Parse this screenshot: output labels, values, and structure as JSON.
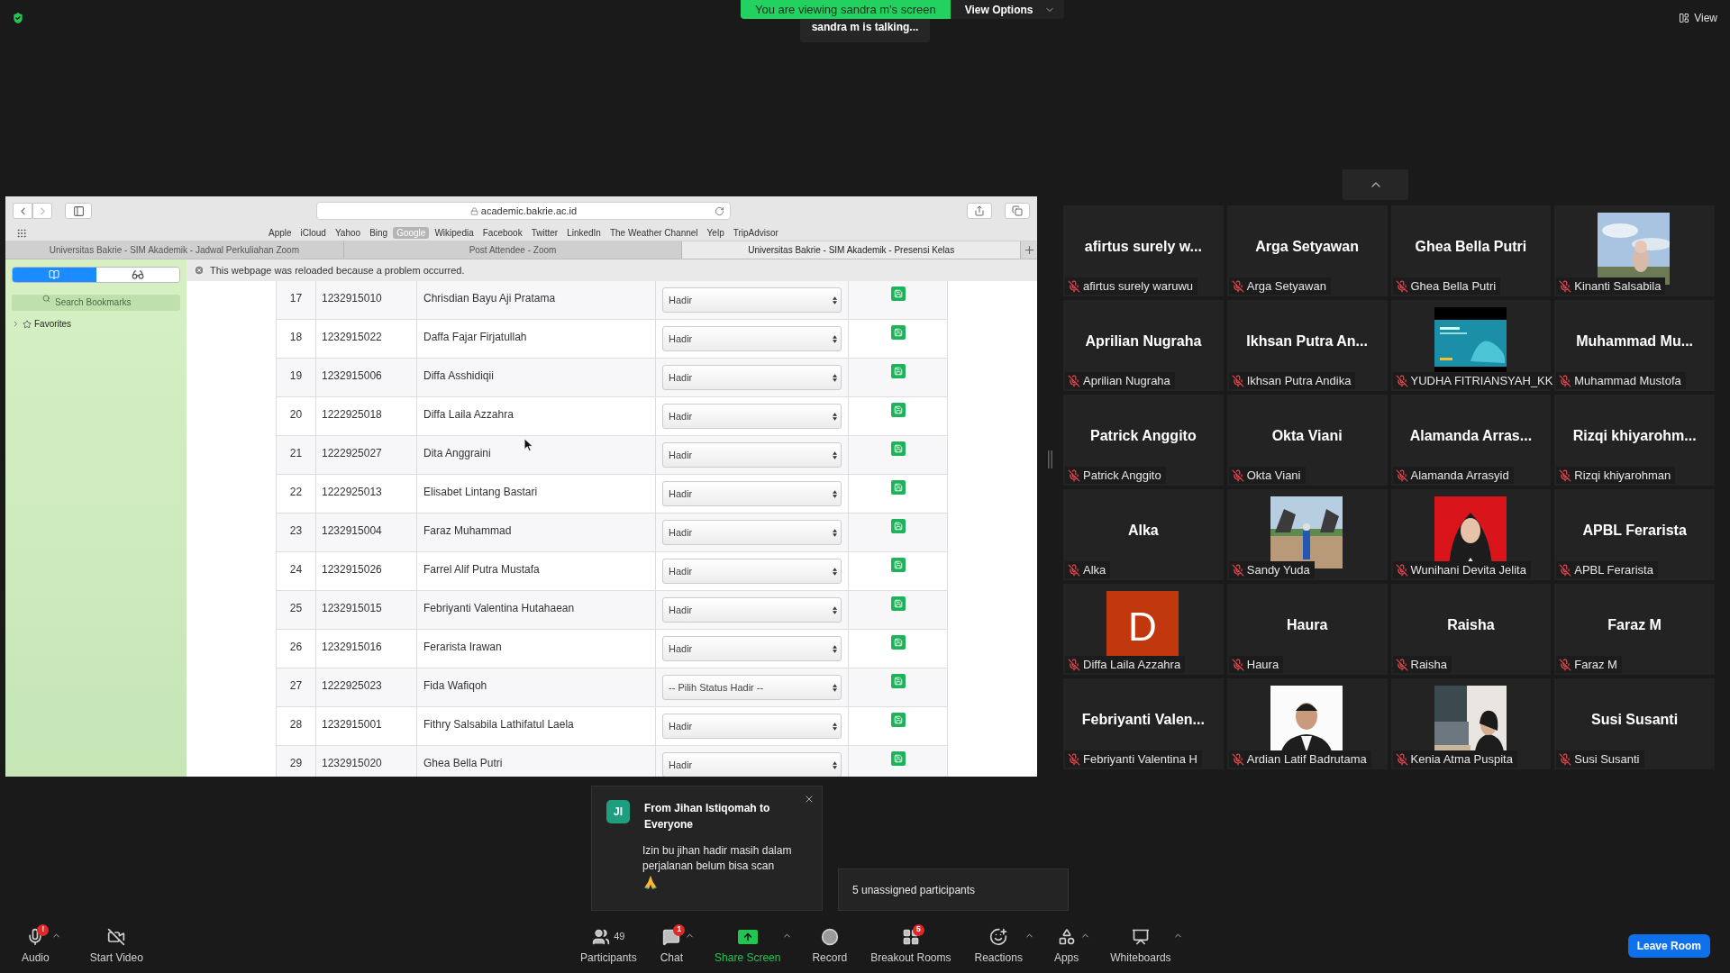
{
  "top": {
    "banner": "You are viewing sandra m's screen",
    "view_options": "View Options",
    "talking": "sandra m is talking...",
    "view": "View"
  },
  "browser": {
    "url": "academic.bakrie.ac.id",
    "bookmarks": [
      {
        "label": "Apple",
        "selected": false
      },
      {
        "label": "iCloud",
        "selected": false
      },
      {
        "label": "Yahoo",
        "selected": false
      },
      {
        "label": "Bing",
        "selected": false
      },
      {
        "label": "Google",
        "selected": true
      },
      {
        "label": "Wikipedia",
        "selected": false
      },
      {
        "label": "Facebook",
        "selected": false
      },
      {
        "label": "Twitter",
        "selected": false
      },
      {
        "label": "LinkedIn",
        "selected": false
      },
      {
        "label": "The Weather Channel",
        "selected": false
      },
      {
        "label": "Yelp",
        "selected": false
      },
      {
        "label": "TripAdvisor",
        "selected": false
      }
    ],
    "tabs": [
      {
        "title": "Universitas Bakrie - SIM Akademik - Jadwal Perkuliahan Zoom",
        "selected": false
      },
      {
        "title": "Post Attendee - Zoom",
        "selected": false
      },
      {
        "title": "Universitas Bakrie - SIM Akademik - Presensi Kelas",
        "selected": true
      }
    ],
    "sidebar": {
      "search_placeholder": "Search Bookmarks",
      "favorites": "Favorites"
    },
    "notice": "This webpage was reloaded because a problem occurred.",
    "rows": [
      {
        "no": "17",
        "nim": "1232915010",
        "name": "Chrisdian Bayu Aji Pratama",
        "status": "Hadir"
      },
      {
        "no": "18",
        "nim": "1232915022",
        "name": "Daffa Fajar Firjatullah",
        "status": "Hadir"
      },
      {
        "no": "19",
        "nim": "1232915006",
        "name": "Diffa Asshidiqii",
        "status": "Hadir"
      },
      {
        "no": "20",
        "nim": "1222925018",
        "name": "Diffa Laila Azzahra",
        "status": "Hadir"
      },
      {
        "no": "21",
        "nim": "1222925027",
        "name": "Dita Anggraini",
        "status": "Hadir"
      },
      {
        "no": "22",
        "nim": "1222925013",
        "name": "Elisabet Lintang Bastari",
        "status": "Hadir"
      },
      {
        "no": "23",
        "nim": "1232915004",
        "name": "Faraz Muhammad",
        "status": "Hadir"
      },
      {
        "no": "24",
        "nim": "1232915026",
        "name": "Farrel Alif Putra Mustafa",
        "status": "Hadir"
      },
      {
        "no": "25",
        "nim": "1232915015",
        "name": "Febriyanti Valentina Hutahaean",
        "status": "Hadir"
      },
      {
        "no": "26",
        "nim": "1232915016",
        "name": "Ferarista Irawan",
        "status": "Hadir"
      },
      {
        "no": "27",
        "nim": "1222925023",
        "name": "Fida Wafiqoh",
        "status": "-- Pilih Status Hadir --"
      },
      {
        "no": "28",
        "nim": "1232915001",
        "name": "Fithry Salsabila Lathifatul Laela",
        "status": "Hadir"
      },
      {
        "no": "29",
        "nim": "1232915020",
        "name": "Ghea Bella Putri",
        "status": "Hadir"
      }
    ]
  },
  "participants": [
    {
      "kind": "name",
      "display": "afirtus surely w...",
      "name": "afirtus surely waruwu",
      "muted": true
    },
    {
      "kind": "name",
      "display": "Arga Setyawan",
      "name": "Arga Setyawan",
      "muted": true
    },
    {
      "kind": "name",
      "display": "Ghea Bella Putri",
      "name": "Ghea Bella Putri",
      "muted": true
    },
    {
      "kind": "picture",
      "name": "Kinanti Salsabila",
      "muted": true
    },
    {
      "kind": "name",
      "display": "Aprilian Nugraha",
      "name": "Aprilian Nugraha",
      "muted": true
    },
    {
      "kind": "name",
      "display": "Ikhsan Putra An...",
      "name": "Ikhsan Putra Andika",
      "muted": true
    },
    {
      "kind": "picture",
      "name": "YUDHA FITRIANSYAH_KK",
      "muted": true
    },
    {
      "kind": "name",
      "display": "Muhammad Mu...",
      "name": "Muhammad Mustofa",
      "muted": true
    },
    {
      "kind": "name",
      "display": "Patrick Anggito",
      "name": "Patrick Anggito",
      "muted": true
    },
    {
      "kind": "name",
      "display": "Okta Viani",
      "name": "Okta Viani",
      "muted": true
    },
    {
      "kind": "name",
      "display": "Alamanda Arras...",
      "name": "Alamanda Arrasyid",
      "muted": true
    },
    {
      "kind": "name",
      "display": "Rizqi khiyarohm...",
      "name": "Rizqi khiyarohman",
      "muted": true
    },
    {
      "kind": "name",
      "display": "Alka",
      "name": "Alka",
      "muted": true
    },
    {
      "kind": "picture",
      "name": "Sandy Yuda",
      "muted": true
    },
    {
      "kind": "picture",
      "name": "Wunihani Devita Jelita",
      "muted": true
    },
    {
      "kind": "name",
      "display": "APBL Ferarista",
      "name": "APBL Ferarista",
      "muted": true
    },
    {
      "kind": "avatar",
      "avatar": "D",
      "color": "#c2380e",
      "name": "Diffa Laila Azzahra",
      "muted": true
    },
    {
      "kind": "name",
      "display": "Haura",
      "name": "Haura",
      "muted": true
    },
    {
      "kind": "name",
      "display": "Raisha",
      "name": "Raisha",
      "muted": true
    },
    {
      "kind": "name",
      "display": "Faraz M",
      "name": "Faraz M",
      "muted": true
    },
    {
      "kind": "name",
      "display": "Febriyanti Valen...",
      "name": "Febriyanti Valentina H",
      "muted": true
    },
    {
      "kind": "picture",
      "name": "Ardian Latif Badrutama",
      "muted": true
    },
    {
      "kind": "picture",
      "name": "Kenia Atma Puspita",
      "muted": true
    },
    {
      "kind": "name",
      "display": "Susi Susanti",
      "name": "Susi Susanti",
      "muted": true
    }
  ],
  "chat": {
    "initials": "JI",
    "title": "From Jihan Istiqomah to Everyone",
    "message": "Izin bu jihan hadir masih dalam perjalanan belum bisa scan"
  },
  "unassigned": "5 unassigned participants",
  "toolbar": [
    {
      "kind": "audio",
      "label": "Audio",
      "badge": "!",
      "caret": true
    },
    {
      "kind": "video",
      "label": "Start Video",
      "caret": false
    },
    {
      "kind": "participants",
      "label": "Participants",
      "count": "49",
      "caret": false
    },
    {
      "kind": "chat",
      "label": "Chat",
      "badge": "1",
      "caret": true
    },
    {
      "kind": "share",
      "label": "Share Screen",
      "caret": true
    },
    {
      "kind": "record",
      "label": "Record",
      "caret": false
    },
    {
      "kind": "breakout",
      "label": "Breakout Rooms",
      "badge": "5",
      "caret": false
    },
    {
      "kind": "reactions",
      "label": "Reactions",
      "caret": true
    },
    {
      "kind": "apps",
      "label": "Apps",
      "caret": true
    },
    {
      "kind": "whiteboards",
      "label": "Whiteboards",
      "caret": true
    }
  ],
  "leave": "Leave Room"
}
